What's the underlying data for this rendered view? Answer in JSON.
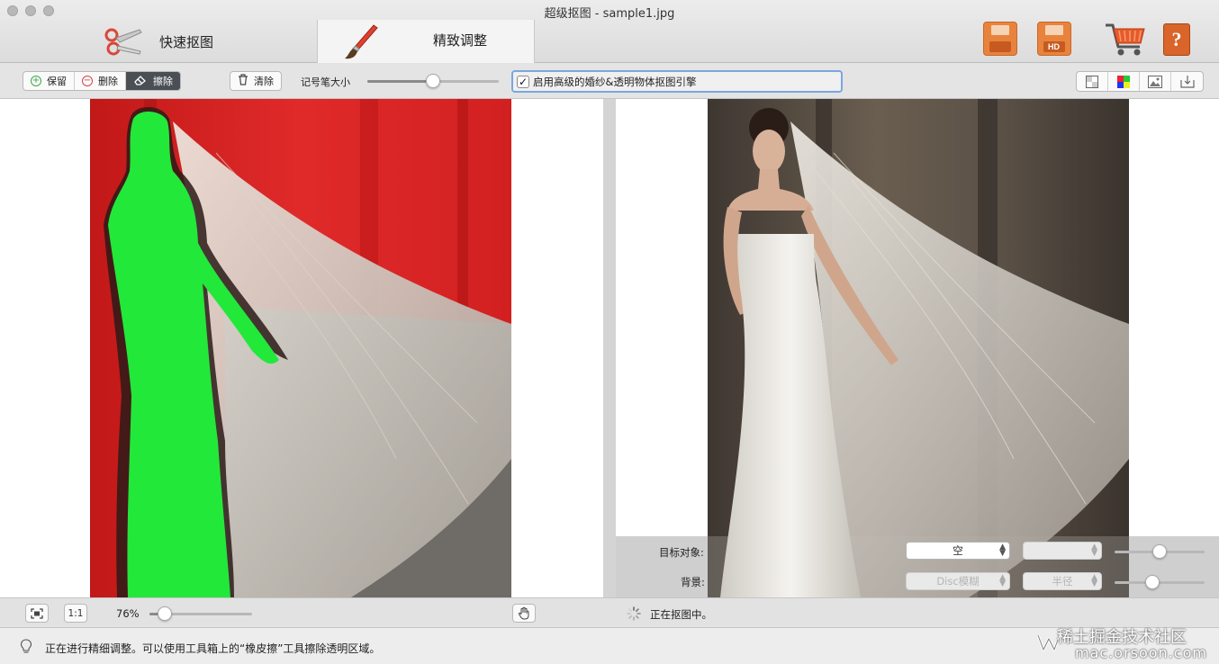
{
  "window": {
    "title": "超级抠图 - sample1.jpg"
  },
  "tabs": [
    {
      "label": "快速抠图",
      "icon": "scissors-icon"
    },
    {
      "label": "精致调整",
      "icon": "paintbrush-icon",
      "active": true
    }
  ],
  "top_actions": [
    "save-icon",
    "save-hd-icon",
    "cart-icon",
    "help-icon"
  ],
  "toolbar": {
    "keep_label": "保留",
    "delete_label": "删除",
    "erase_label": "擦除",
    "active_tool": "擦除",
    "clear_label": "清除",
    "brush_size_label": "记号笔大小",
    "brush_size_value": 0.5,
    "advanced_checkbox_label": "启用高级的婚纱&透明物体抠图引擎",
    "advanced_checkbox_checked": true,
    "view_buttons": [
      "transparent-view-icon",
      "color-view-icon",
      "image-view-icon",
      "export-icon"
    ]
  },
  "right_panel": {
    "target_label": "目标对象:",
    "target_value": "空",
    "target_secondary_value": "",
    "background_label": "背景:",
    "background_value": "Disc模糊",
    "radius_value": "半径",
    "target_slider_value": 0.5,
    "background_slider_value": 0.42
  },
  "bottom_bar": {
    "fit_icon": "fit-screen-icon",
    "actual_size_label": "1:1",
    "zoom_label": "76%",
    "zoom_value": 0.15,
    "hand_icon": "hand-tool-icon",
    "status_text": "正在抠图中。"
  },
  "hint_bar": {
    "text": "正在进行精细调整。可以使用工具箱上的“橡皮擦”工具擦除透明区域。"
  },
  "watermark": {
    "line1": "稀土掘金技术社区",
    "line2": "mac.orsoon.com"
  },
  "colors": {
    "keep_mask": "#22e83a",
    "remove_mask": "#e62a2a",
    "accent_focus": "#7aa7e0",
    "active_segment": "#4a4e55"
  }
}
